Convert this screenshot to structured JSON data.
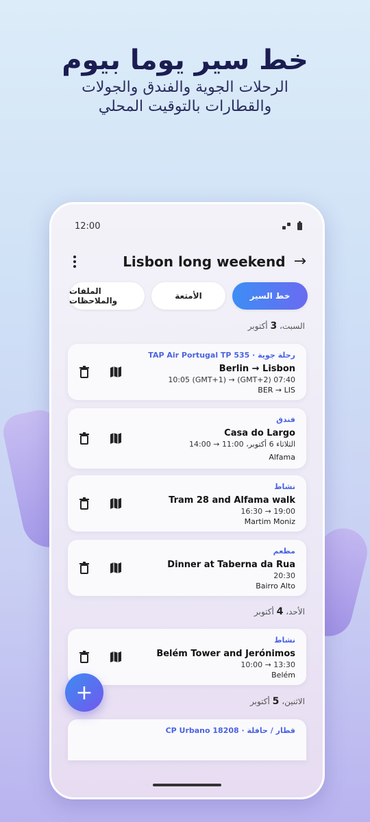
{
  "hero": {
    "title": "خط سير يوما بيوم",
    "subtitle_line1": "الرحلات الجوية والفندق والجولات",
    "subtitle_line2": "والقطارات بالتوقيت المحلي"
  },
  "status": {
    "time": "12:00"
  },
  "header": {
    "title": "Lisbon long weekend"
  },
  "tabs": [
    {
      "label": "خط السير",
      "active": true
    },
    {
      "label": "الأمتعة"
    },
    {
      "label": "الملفات والملاحظات"
    }
  ],
  "days": [
    {
      "label": "السبت،",
      "num": "3",
      "month": "أكتوبر"
    },
    {
      "label": "الأحد،",
      "num": "4",
      "month": "أكتوبر"
    },
    {
      "label": "الاثنين،",
      "num": "5",
      "month": "أكتوبر"
    }
  ],
  "cards": [
    {
      "category": "رحلة جوية · TAP Air Portugal TP 535",
      "name": "Berlin → Lisbon",
      "time": "10:05 (GMT+1) → (GMT+2) 07:40",
      "place": "BER → LIS"
    },
    {
      "category": "فندق",
      "name": "Casa do Largo",
      "time": "14:00 → الثلاثاء 6 أكتوبر، 11:00",
      "place": "Alfama"
    },
    {
      "category": "نشاط",
      "name": "Tram 28 and Alfama walk",
      "time": "16:30 → 19:00",
      "place": "Martim Moniz"
    },
    {
      "category": "مطعم",
      "name": "Dinner at Taberna da Rua",
      "time": "20:30",
      "place": "Bairro Alto"
    },
    {
      "category": "نشاط",
      "name": "Belém Tower and Jerónimos",
      "time": "10:00 → 13:30",
      "place": "Belém"
    },
    {
      "category": "قطار / حافلة · CP Urbano 18208",
      "name": "",
      "time": "",
      "place": ""
    }
  ],
  "fab": {
    "label": "+"
  },
  "icons": {
    "delete": "trash-icon",
    "map": "map-icon",
    "more": "more-vertical-icon",
    "forward": "arrow-right-icon"
  }
}
